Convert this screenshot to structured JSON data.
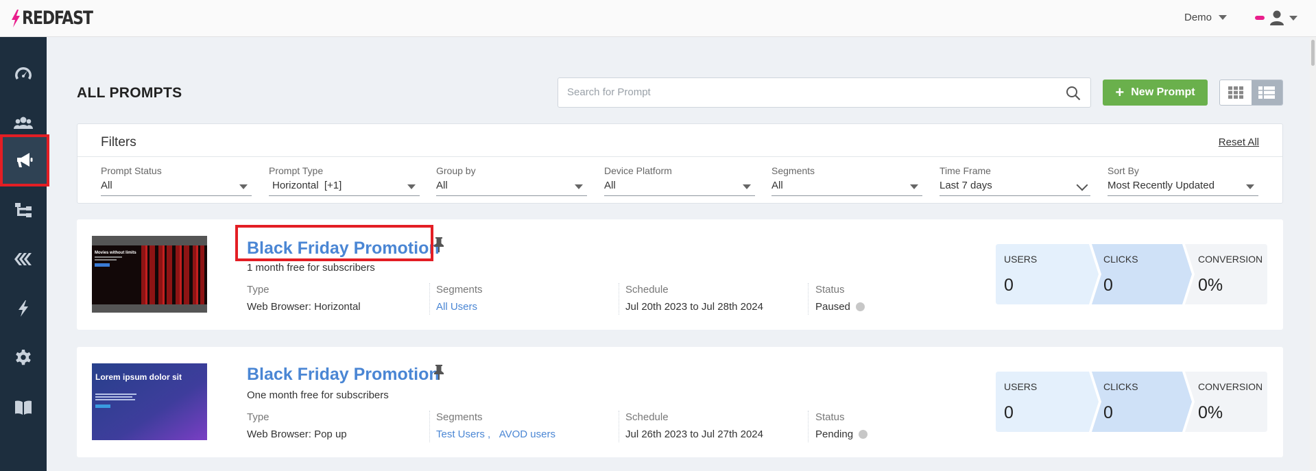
{
  "app": {
    "logo": "REDFAST"
  },
  "topbar": {
    "account": "Demo"
  },
  "colors": {
    "accent": "#4a86d4",
    "primary_button": "#6ab04c",
    "sidebar": "#1d2e3e",
    "brand": "#e91e8c"
  },
  "sidebar": {
    "items": [
      {
        "icon": "dashboard-gauge-icon"
      },
      {
        "icon": "users-group-icon"
      },
      {
        "icon": "megaphone-icon",
        "active": true
      },
      {
        "icon": "flow-tree-icon"
      },
      {
        "icon": "layers-icon"
      },
      {
        "icon": "lightning-bolt-icon"
      },
      {
        "icon": "gear-icon"
      },
      {
        "icon": "book-icon"
      }
    ]
  },
  "header": {
    "title": "ALL PROMPTS",
    "search_placeholder": "Search for Prompt",
    "new_button": "New Prompt"
  },
  "filters": {
    "title": "Filters",
    "reset": "Reset All",
    "fields": [
      {
        "label": "Prompt Status",
        "value": "All"
      },
      {
        "label": "Prompt Type",
        "value": "Horizontal  [+1]"
      },
      {
        "label": "Group by",
        "value": "All"
      },
      {
        "label": "Device Platform",
        "value": "All"
      },
      {
        "label": "Segments",
        "value": "All"
      },
      {
        "label": "Time Frame",
        "value": "Last 7 days"
      },
      {
        "label": "Sort By",
        "value": "Most Recently Updated"
      }
    ]
  },
  "meta_labels": {
    "type": "Type",
    "segments": "Segments",
    "schedule": "Schedule",
    "status": "Status"
  },
  "stat_labels": {
    "users": "USERS",
    "clicks": "CLICKS",
    "conversion": "CONVERSION"
  },
  "prompts": [
    {
      "title": "Black Friday Promotion",
      "subtitle": "1 month free for subscribers",
      "type": "Web Browser: Horizontal",
      "segments": [
        "All Users"
      ],
      "schedule": "Jul 20th 2023 to Jul 28th 2024",
      "status": "Paused",
      "users": "0",
      "clicks": "0",
      "conversion": "0%",
      "thumb_text": "Movies without limits"
    },
    {
      "title": "Black Friday Promotion",
      "subtitle": "One month free for subscribers",
      "type": "Web Browser: Pop up",
      "segments": [
        "Test Users",
        "AVOD users"
      ],
      "schedule": "Jul 26th 2023 to Jul 27th 2024",
      "status": "Pending",
      "users": "0",
      "clicks": "0",
      "conversion": "0%",
      "thumb_text": "Lorem ipsum dolor sit"
    }
  ]
}
